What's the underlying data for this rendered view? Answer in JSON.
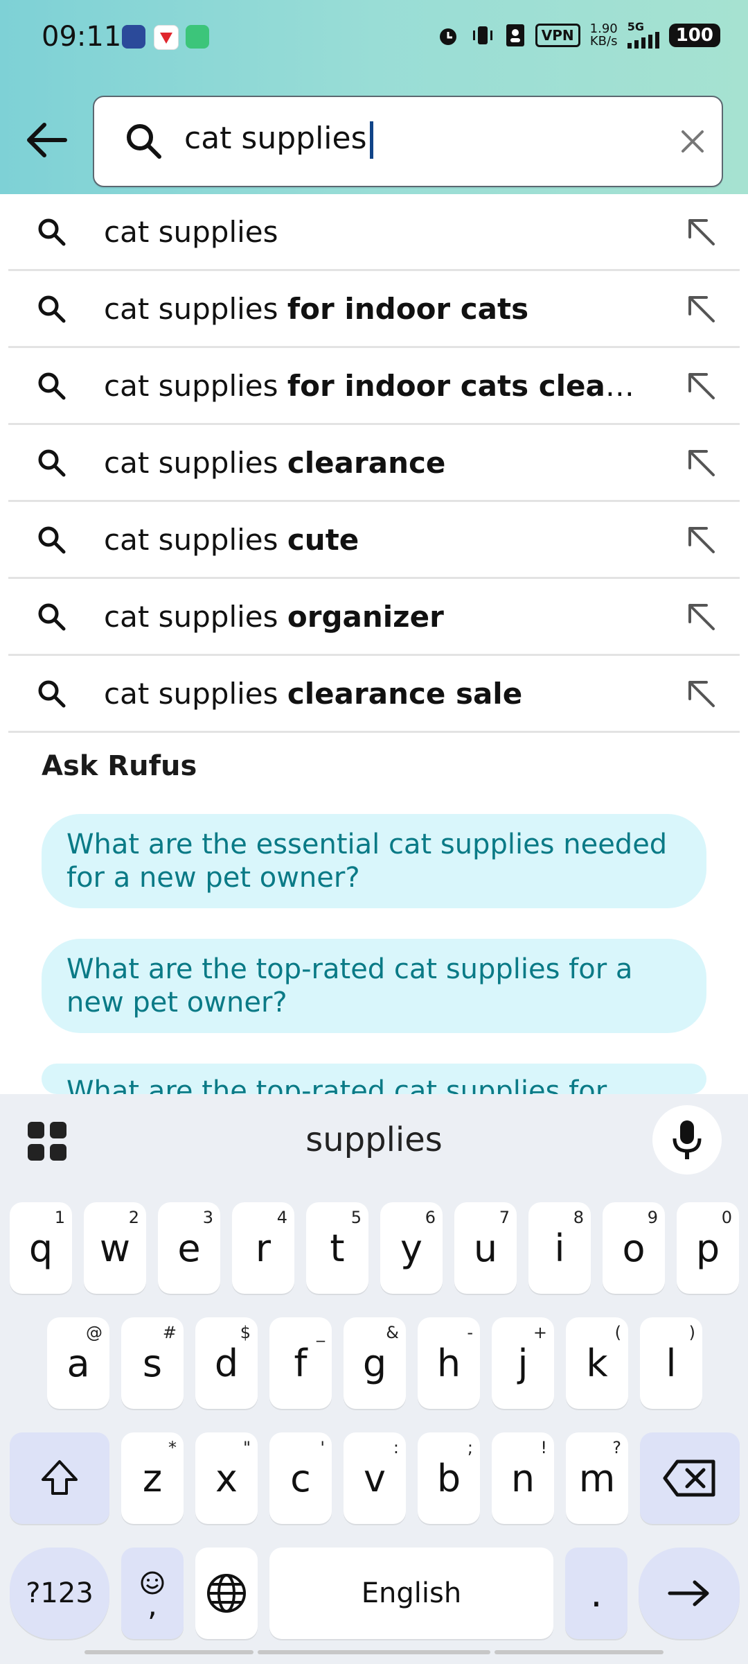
{
  "status_bar": {
    "time": "09:11",
    "vpn": "VPN",
    "speed_top": "1.90",
    "speed_bottom": "KB/s",
    "network": "5G",
    "battery": "100"
  },
  "search": {
    "query": "cat supplies"
  },
  "suggestions": [
    {
      "prefix": "cat supplies",
      "suffix": ""
    },
    {
      "prefix": "cat supplies ",
      "suffix": "for indoor cats"
    },
    {
      "prefix": "cat supplies ",
      "suffix": "for indoor cats clear…"
    },
    {
      "prefix": "cat supplies ",
      "suffix": "clearance"
    },
    {
      "prefix": "cat supplies ",
      "suffix": "cute"
    },
    {
      "prefix": "cat supplies ",
      "suffix": "organizer"
    },
    {
      "prefix": "cat supplies ",
      "suffix": "clearance sale"
    }
  ],
  "rufus": {
    "title": "Ask Rufus",
    "questions": [
      "What are the essential cat supplies needed for a new pet owner?",
      "What are the top-rated cat supplies for a new pet owner?",
      "What are the top-rated cat supplies for"
    ]
  },
  "keyboard": {
    "suggestion": "supplies",
    "row1": [
      {
        "k": "q",
        "h": "1"
      },
      {
        "k": "w",
        "h": "2"
      },
      {
        "k": "e",
        "h": "3"
      },
      {
        "k": "r",
        "h": "4"
      },
      {
        "k": "t",
        "h": "5"
      },
      {
        "k": "y",
        "h": "6"
      },
      {
        "k": "u",
        "h": "7"
      },
      {
        "k": "i",
        "h": "8"
      },
      {
        "k": "o",
        "h": "9"
      },
      {
        "k": "p",
        "h": "0"
      }
    ],
    "row2": [
      {
        "k": "a",
        "h": "@"
      },
      {
        "k": "s",
        "h": "#"
      },
      {
        "k": "d",
        "h": "$"
      },
      {
        "k": "f",
        "h": "_"
      },
      {
        "k": "g",
        "h": "&"
      },
      {
        "k": "h",
        "h": "-"
      },
      {
        "k": "j",
        "h": "+"
      },
      {
        "k": "k",
        "h": "("
      },
      {
        "k": "l",
        "h": ")"
      }
    ],
    "row3": [
      {
        "k": "z",
        "h": "*"
      },
      {
        "k": "x",
        "h": "\""
      },
      {
        "k": "c",
        "h": "'"
      },
      {
        "k": "v",
        "h": ":"
      },
      {
        "k": "b",
        "h": ";"
      },
      {
        "k": "n",
        "h": "!"
      },
      {
        "k": "m",
        "h": "?"
      }
    ],
    "sym_key": "?123",
    "emoji_comma": ",",
    "space": "English",
    "period": "."
  }
}
